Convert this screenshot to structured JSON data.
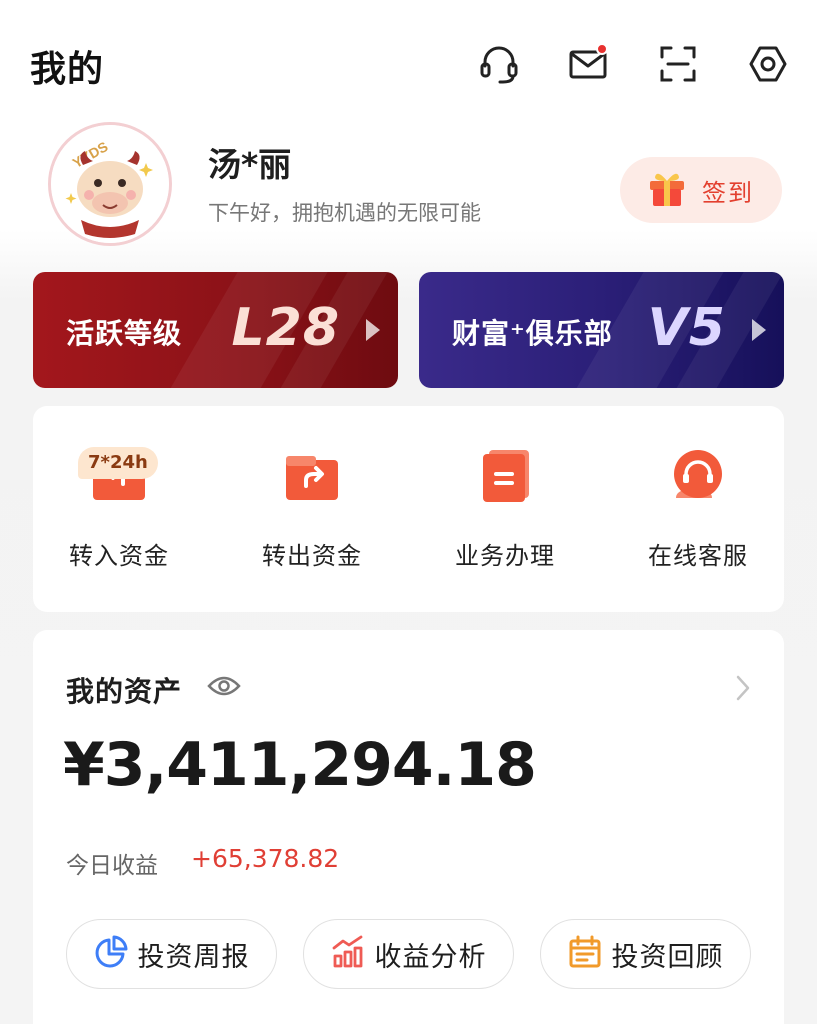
{
  "header": {
    "title": "我的"
  },
  "header_icons": [
    "headset-icon",
    "mail-icon",
    "scan-icon",
    "settings-icon"
  ],
  "profile": {
    "name": "汤*丽",
    "greeting": "下午好，拥抱机遇的无限可能",
    "avatar_text": "YYDS",
    "signin_label": "签到"
  },
  "level_cards": {
    "activity": {
      "label": "活跃等级",
      "level": "L28"
    },
    "wealth": {
      "label": "财富⁺俱乐部",
      "level": "V5"
    }
  },
  "quick_actions": {
    "badge": "7*24h",
    "items": [
      {
        "label": "转入资金",
        "icon": "transfer-in-icon"
      },
      {
        "label": "转出资金",
        "icon": "transfer-out-icon"
      },
      {
        "label": "业务办理",
        "icon": "business-icon"
      },
      {
        "label": "在线客服",
        "icon": "customer-service-icon"
      }
    ]
  },
  "assets": {
    "title": "我的资产",
    "amount": "¥3,411,294.18",
    "today_label": "今日收益",
    "today_value": "+65,378.82",
    "buttons": [
      {
        "label": "投资周报",
        "icon": "pie-chart-icon"
      },
      {
        "label": "收益分析",
        "icon": "bar-chart-icon"
      },
      {
        "label": "投资回顾",
        "icon": "calendar-icon"
      }
    ]
  },
  "colors": {
    "accent_red": "#e3402f",
    "activity_card": "#8c1218",
    "wealth_card": "#2b1f78",
    "profit_red": "#e03f35"
  }
}
